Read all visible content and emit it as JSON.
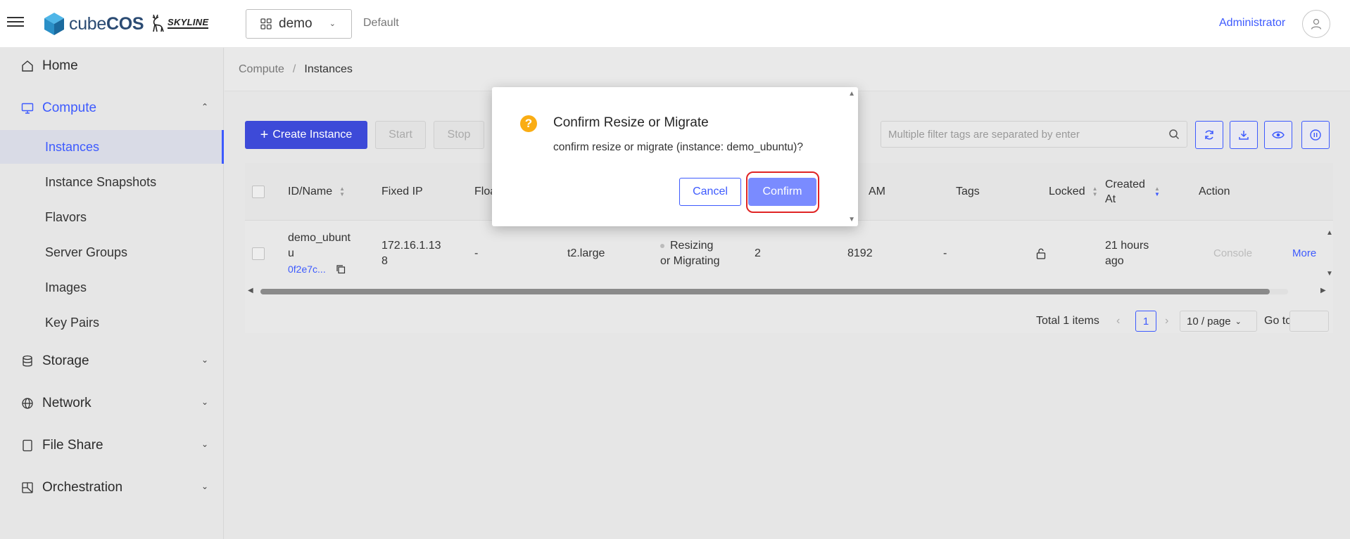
{
  "header": {
    "logo_text_light": "cube",
    "logo_text_bold": "COS",
    "partner_logo": "SKYLINE",
    "project": "demo",
    "domain": "Default",
    "user": "Administrator"
  },
  "sidebar": {
    "items": [
      {
        "label": "Home",
        "icon": "home-icon"
      },
      {
        "label": "Compute",
        "icon": "monitor-icon",
        "expanded": true
      },
      {
        "label": "Storage",
        "icon": "database-icon"
      },
      {
        "label": "Network",
        "icon": "globe-icon"
      },
      {
        "label": "File Share",
        "icon": "file-share-icon"
      },
      {
        "label": "Orchestration",
        "icon": "orchestration-icon"
      }
    ],
    "compute_sub": [
      "Instances",
      "Instance Snapshots",
      "Flavors",
      "Server Groups",
      "Images",
      "Key Pairs"
    ],
    "active_sub": "Instances"
  },
  "breadcrumb": [
    "Compute",
    "Instances"
  ],
  "toolbar": {
    "create_label": "Create Instance",
    "start_label": "Start",
    "stop_label": "Stop",
    "search_placeholder": "Multiple filter tags are separated by enter"
  },
  "table": {
    "columns": [
      "ID/Name",
      "Fixed IP",
      "Floa",
      "AM",
      "Tags",
      "Locked",
      "Created At",
      "Action"
    ],
    "row": {
      "name": "demo_ubuntu",
      "name_line1": "demo_ubunt",
      "name_line2": "u",
      "id_short": "0f2e7c...",
      "fixed_ip_line1": "172.16.1.13",
      "fixed_ip_line2": "8",
      "floating_ip": "-",
      "flavor": "t2.large",
      "status_line1": "Resizing",
      "status_line2": "or Migrating",
      "vcpu": "2",
      "ram": "8192",
      "tags": "-",
      "created_line1": "21 hours",
      "created_line2": "ago",
      "action_console": "Console",
      "action_more": "More"
    }
  },
  "pagination": {
    "total": "Total 1 items",
    "current_page": "1",
    "page_size": "10 / page",
    "goto_label": "Go to"
  },
  "modal": {
    "title": "Confirm Resize or Migrate",
    "message": "confirm resize or migrate (instance: demo_ubuntu)?",
    "cancel_label": "Cancel",
    "confirm_label": "Confirm"
  },
  "colors": {
    "accent": "#3d5afe",
    "primary_button": "#3d4ad8",
    "confirm_button": "#7a8bff",
    "warning_icon": "#faad14",
    "highlight_ring": "#e02424"
  }
}
